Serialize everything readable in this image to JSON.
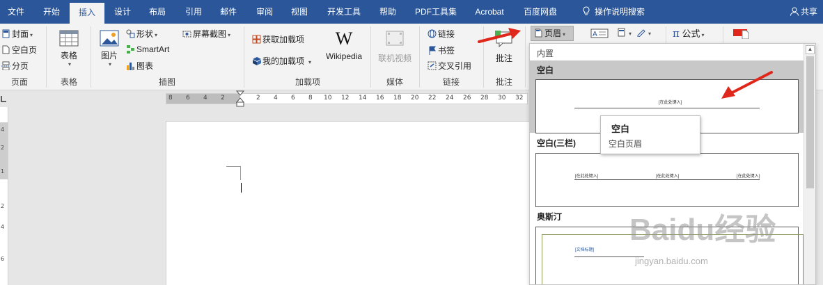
{
  "tabs": [
    {
      "label": "文件",
      "active": false
    },
    {
      "label": "开始",
      "active": false
    },
    {
      "label": "插入",
      "active": true
    },
    {
      "label": "设计",
      "active": false
    },
    {
      "label": "布局",
      "active": false
    },
    {
      "label": "引用",
      "active": false
    },
    {
      "label": "邮件",
      "active": false
    },
    {
      "label": "审阅",
      "active": false
    },
    {
      "label": "视图",
      "active": false
    },
    {
      "label": "开发工具",
      "active": false
    },
    {
      "label": "帮助",
      "active": false
    },
    {
      "label": "PDF工具集",
      "active": false
    },
    {
      "label": "Acrobat",
      "active": false
    },
    {
      "label": "百度网盘",
      "active": false
    }
  ],
  "tell_me": {
    "label": "操作说明搜索",
    "icon": "lightbulb-icon"
  },
  "share": {
    "label": "共享",
    "icon": "person-icon"
  },
  "ribbon": {
    "pages": {
      "cover": "封面",
      "blank": "空白页",
      "break": "分页",
      "group": "页面"
    },
    "tables": {
      "table": "表格",
      "group": "表格"
    },
    "illustrations": {
      "pictures": "图片",
      "shapes": "形状",
      "smartart": "SmartArt",
      "chart": "图表",
      "screenshot": "屏幕截图",
      "group": "插图"
    },
    "addins": {
      "get": "获取加载项",
      "my": "我的加载项",
      "wikipedia": "Wikipedia",
      "group": "加载项"
    },
    "media": {
      "online_video": "联机视频",
      "group": "媒体"
    },
    "links": {
      "link": "链接",
      "bookmark": "书签",
      "cross_ref": "交叉引用",
      "group": "链接"
    },
    "comments": {
      "comment": "批注",
      "group": "批注"
    },
    "header_footer": {
      "header": "页眉"
    },
    "symbols": {
      "equation": "公式"
    }
  },
  "ruler": {
    "labels": [
      "8",
      "6",
      "4",
      "2",
      "2",
      "4",
      "6",
      "8",
      "10",
      "12",
      "14",
      "16",
      "18",
      "20",
      "22",
      "24",
      "26",
      "28",
      "30",
      "32"
    ],
    "vertical_labels": [
      "4",
      "2",
      "1",
      "2",
      "4",
      "6"
    ]
  },
  "gallery": {
    "section": "内置",
    "items": [
      {
        "name": "空白",
        "placeholder": "[在此处键入]"
      },
      {
        "name": "空白(三栏)",
        "placeholder": "[在此处键入]"
      },
      {
        "name": "奥斯汀",
        "placeholder": "[文档标题]"
      }
    ]
  },
  "tooltip": {
    "title": "空白",
    "description": "空白页眉"
  },
  "watermark": {
    "brand": "Baidu经验",
    "url": "jingyan.baidu.com"
  },
  "colors": {
    "accent": "#2b579a",
    "annotation_arrow": "#e0271c"
  }
}
